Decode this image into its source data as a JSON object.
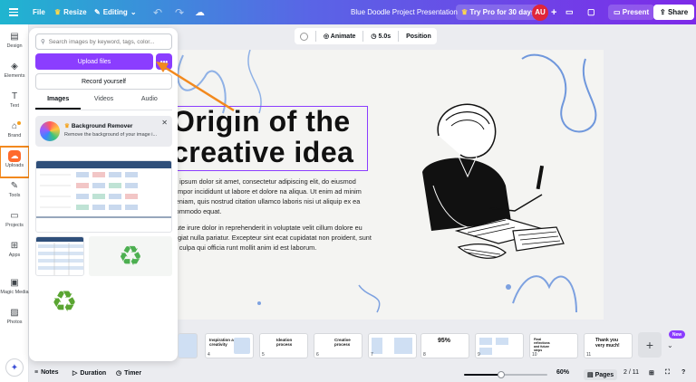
{
  "topbar": {
    "file": "File",
    "resize": "Resize",
    "editing": "Editing",
    "title": "Blue Doodle Project Presentation",
    "try_pro": "Try Pro for 30 days",
    "avatar_initials": "AU",
    "present": "Present",
    "share": "Share"
  },
  "rail": {
    "items": [
      {
        "label": "Design",
        "icon": "design-icon"
      },
      {
        "label": "Elements",
        "icon": "elements-icon"
      },
      {
        "label": "Text",
        "icon": "text-icon"
      },
      {
        "label": "Brand",
        "icon": "brand-icon"
      },
      {
        "label": "Uploads",
        "icon": "upload-cloud-icon"
      },
      {
        "label": "Tools",
        "icon": "tools-icon"
      },
      {
        "label": "Projects",
        "icon": "folder-icon"
      },
      {
        "label": "Apps",
        "icon": "apps-icon"
      },
      {
        "label": "Magic Media",
        "icon": "magic-media-icon"
      },
      {
        "label": "Photos",
        "icon": "photos-icon"
      }
    ]
  },
  "panel": {
    "search_placeholder": "Search images by keyword, tags, color...",
    "upload_label": "Upload files",
    "more_label": "•••",
    "record_label": "Record yourself",
    "tabs": [
      "Images",
      "Videos",
      "Audio"
    ],
    "active_tab": "Images",
    "bg_remover": {
      "title": "Background Remover",
      "desc": "Remove the background of your image i..."
    }
  },
  "canvas_toolbar": {
    "animate": "Animate",
    "duration": "5.0s",
    "position": "Position"
  },
  "slide": {
    "heading_line1": "Origin of the",
    "heading_line2": "creative idea",
    "para1": "m ipsum dolor sit amet, consectetur adipiscing elit, do eiusmod tempor incididunt ut labore et dolore na aliqua. Ut enim ad minim veniam, quis nostrud citation ullamco laboris nisi ut aliquip ex ea commodo equat.",
    "para2": "aute irure dolor in reprehenderit in voluptate velit cillum dolore eu fugiat nulla pariatur. Excepteur sint ecat cupidatat non proident, sunt in culpa qui officia runt mollit anim id est laborum."
  },
  "pages": {
    "thumbs": [
      {
        "num": "",
        "title": ""
      },
      {
        "num": "4",
        "title": "Inspiration and creativity"
      },
      {
        "num": "5",
        "title": "Ideation process"
      },
      {
        "num": "6",
        "title": "Creative process"
      },
      {
        "num": "7",
        "title": ""
      },
      {
        "num": "8",
        "title": "95%"
      },
      {
        "num": "9",
        "title": ""
      },
      {
        "num": "10",
        "title": "Final reflections and future steps"
      },
      {
        "num": "11",
        "title": "Thank you very much!"
      }
    ],
    "add": "+",
    "new_badge": "New"
  },
  "footer": {
    "notes": "Notes",
    "duration": "Duration",
    "timer": "Timer",
    "zoom": "60%",
    "zoom_fraction": 0.45,
    "pages": "Pages",
    "page_count": "2 / 11"
  },
  "colors": {
    "accent": "#8b3dff",
    "highlight": "#f2891e"
  }
}
